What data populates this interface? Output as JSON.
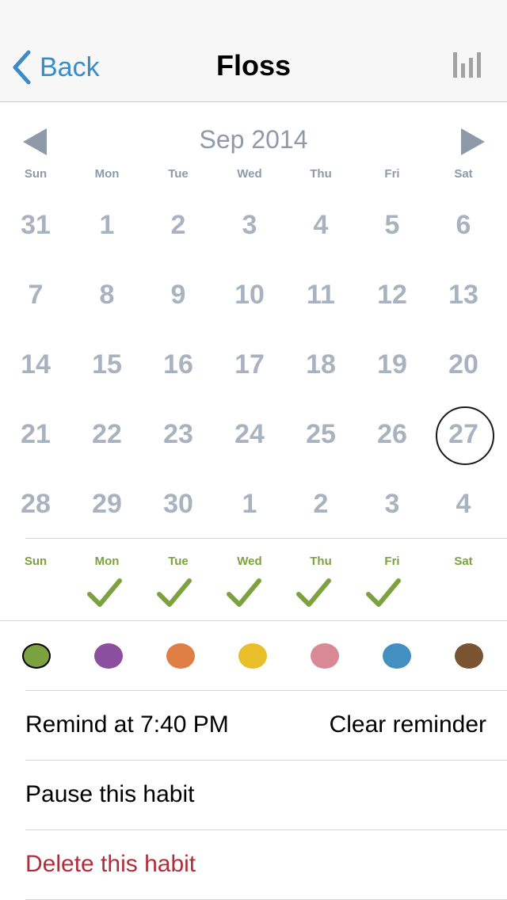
{
  "nav": {
    "back_label": "Back",
    "title": "Floss"
  },
  "calendar": {
    "month_label": "Sep 2014",
    "weekdays": [
      "Sun",
      "Mon",
      "Tue",
      "Wed",
      "Thu",
      "Fri",
      "Sat"
    ],
    "weeks": [
      [
        "31",
        "1",
        "2",
        "3",
        "4",
        "5",
        "6"
      ],
      [
        "7",
        "8",
        "9",
        "10",
        "11",
        "12",
        "13"
      ],
      [
        "14",
        "15",
        "16",
        "17",
        "18",
        "19",
        "20"
      ],
      [
        "21",
        "22",
        "23",
        "24",
        "25",
        "26",
        "27"
      ],
      [
        "28",
        "29",
        "30",
        "1",
        "2",
        "3",
        "4"
      ]
    ],
    "today": "27"
  },
  "habit_days": {
    "weekdays": [
      "Sun",
      "Mon",
      "Tue",
      "Wed",
      "Thu",
      "Fri",
      "Sat"
    ],
    "checked": [
      false,
      true,
      true,
      true,
      true,
      true,
      false
    ],
    "check_color": "#7ba23f"
  },
  "colors": {
    "options": [
      "#7ba23f",
      "#8a4f9e",
      "#e07f45",
      "#e8bf2a",
      "#d98895",
      "#4390c0",
      "#7a5430"
    ],
    "selected_index": 0
  },
  "reminder": {
    "label": "Remind at 7:40 PM",
    "clear_label": "Clear reminder"
  },
  "actions": {
    "pause_label": "Pause this habit",
    "delete_label": "Delete this habit"
  },
  "theme": {
    "accent": "#3a8bc7",
    "muted_text": "#8e9aa8",
    "danger": "#b22d3a"
  }
}
